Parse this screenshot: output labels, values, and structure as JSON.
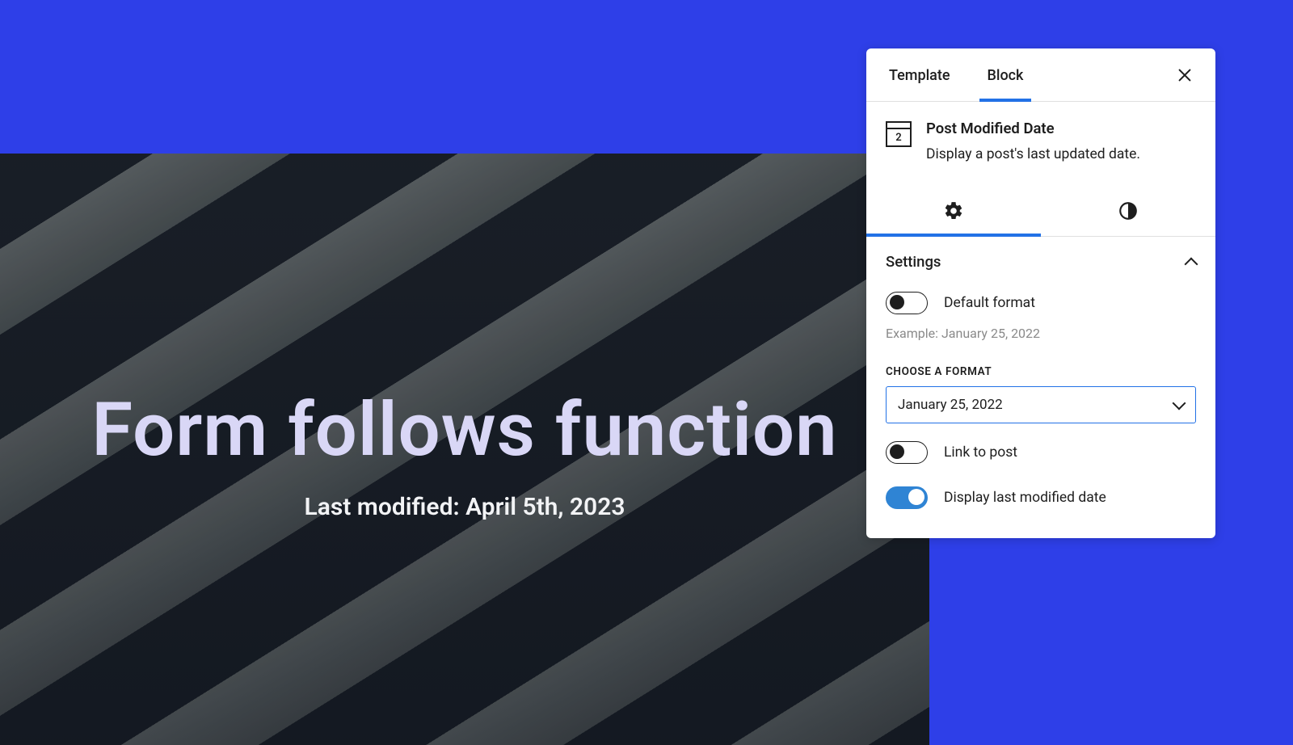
{
  "preview": {
    "title": "Form follows function",
    "subtitle": "Last modified: April 5th, 2023"
  },
  "panel": {
    "tabs": {
      "template": "Template",
      "block": "Block"
    },
    "calendar_day": "2",
    "block_title": "Post Modified Date",
    "block_desc": "Display a post's last updated date.",
    "settings_label": "Settings",
    "default_format_label": "Default format",
    "example_label": "Example: January 25, 2022",
    "choose_format_label": "CHOOSE A FORMAT",
    "format_value": "January 25, 2022",
    "link_to_post_label": "Link to post",
    "display_modified_label": "Display last modified date",
    "toggles": {
      "default_format": false,
      "link_to_post": false,
      "display_modified": true
    }
  }
}
